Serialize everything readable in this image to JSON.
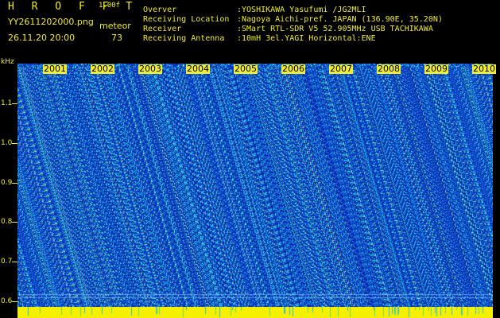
{
  "header": {
    "app_title": "H R O F F T",
    "version": "1.00f",
    "filename": "YY2611202000.png",
    "mode": "meteor",
    "datetime": "26.11.20 20:00",
    "count": "73"
  },
  "meta": [
    {
      "label": "Overver",
      "value": ":YOSHIKAWA Yasufumi /JG2MLI"
    },
    {
      "label": "Receiving Location",
      "value": ":Nagoya Aichi-pref. JAPAN (136.90E, 35.20N)"
    },
    {
      "label": "Receiver",
      "value": ":SMart RTL-SDR V5 52.905MHz USB TACHIKAWA"
    },
    {
      "label": "Receiving Antenna",
      "value": ":10mH 3el.YAGI Horizontal:ENE"
    }
  ],
  "axis": {
    "y_unit": "kHz",
    "y_ticks": [
      "1.1",
      "1.0",
      "0.9",
      "0.8",
      "0.7",
      "0.6"
    ],
    "x_ticks": [
      "2001",
      "2002",
      "2003",
      "2004",
      "2005",
      "2006",
      "2007",
      "2008",
      "2009",
      "2010"
    ]
  },
  "colors": {
    "background": "#000000",
    "text": "#f0ec30",
    "waterfall_base": "#1a2fc8",
    "baseline": "#f5f000"
  }
}
